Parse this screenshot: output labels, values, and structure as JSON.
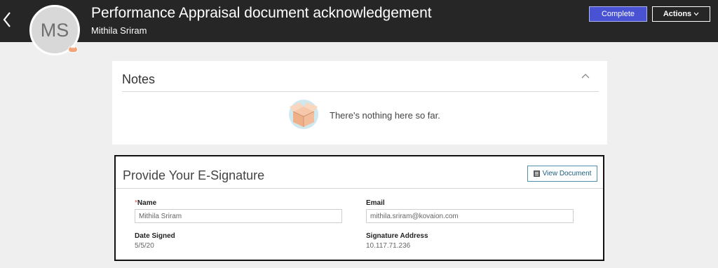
{
  "header": {
    "title": "Performance Appraisal document acknowledgement",
    "subtitle": "Mithila Sriram",
    "avatar_initials": "MS",
    "presence_badge": "•••",
    "complete_label": "Complete",
    "actions_label": "Actions"
  },
  "notes": {
    "title": "Notes",
    "empty_text": "There's nothing here so far."
  },
  "signature": {
    "title": "Provide Your E-Signature",
    "view_document_label": "View Document",
    "required_marker": "*",
    "name_label": "Name",
    "name_value": "Mithila Sriram",
    "email_label": "Email",
    "email_value": "mithila.sriram@kovaion.com",
    "date_label": "Date Signed",
    "date_value": "5/5/20",
    "address_label": "Signature Address",
    "address_value": "10.117.71.236"
  },
  "colors": {
    "header_bg": "#262626",
    "primary_button": "#4a52d4",
    "page_bg": "#efefef",
    "presence": "#f2a37a"
  },
  "icons": [
    "back-arrow-icon",
    "chevron-down-icon",
    "chevron-up-icon",
    "empty-box-icon",
    "document-icon"
  ]
}
